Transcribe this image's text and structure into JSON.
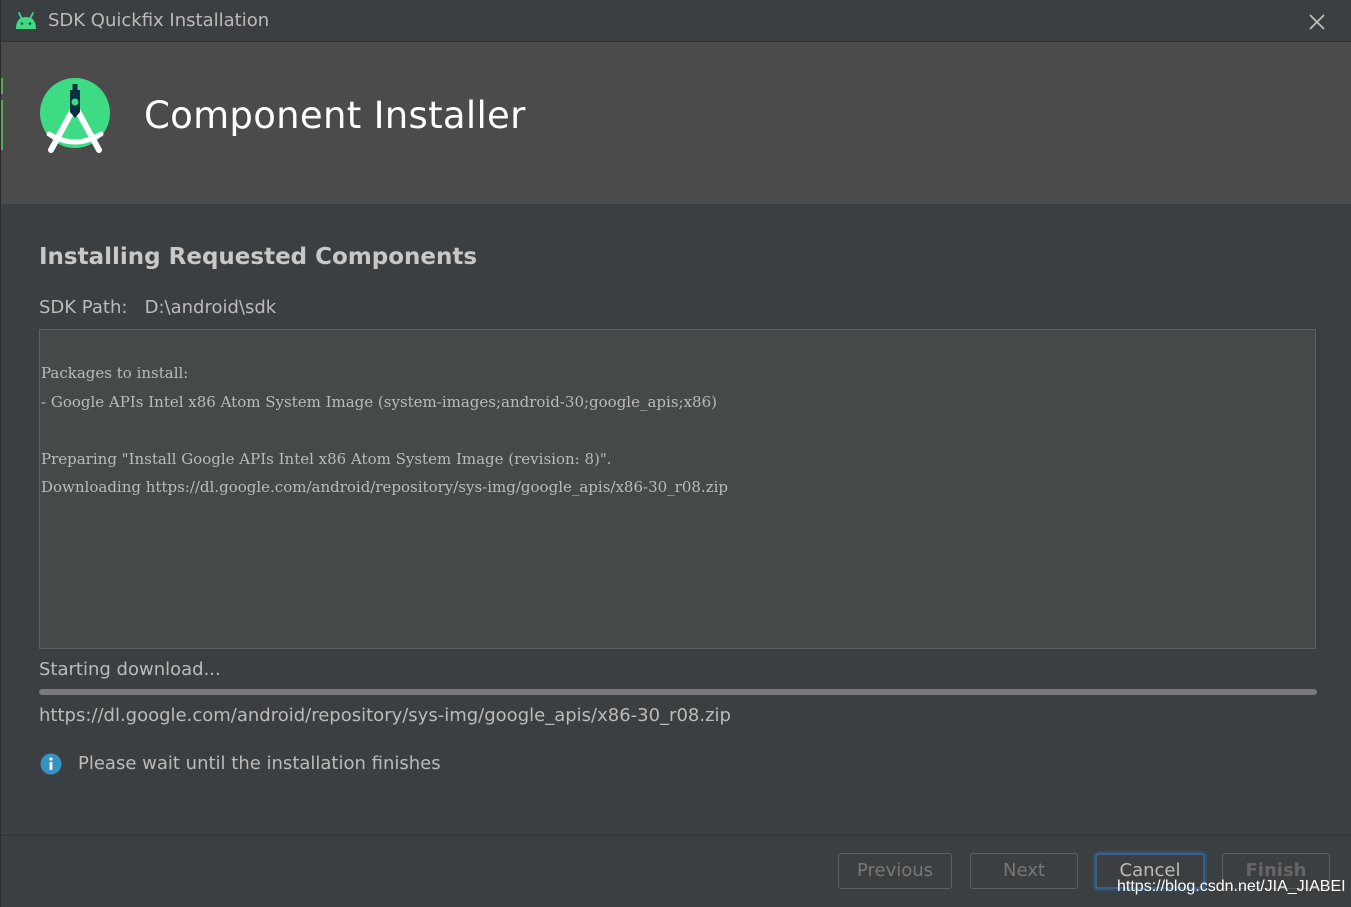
{
  "window": {
    "title": "SDK Quickfix Installation",
    "app_icon": "android-robot-icon",
    "close_icon": "close-icon"
  },
  "banner": {
    "logo": "android-studio-logo-icon",
    "title": "Component Installer"
  },
  "content": {
    "heading": "Installing Requested Components",
    "sdk_path_label": "SDK Path:",
    "sdk_path_value": "D:\\android\\sdk",
    "log_lines": [
      "Packages to install:",
      "- Google APIs Intel x86 Atom System Image (system-images;android-30;google_apis;x86)",
      "",
      "Preparing \"Install Google APIs Intel x86 Atom System Image (revision: 8)\".",
      "Downloading https://dl.google.com/android/repository/sys-img/google_apis/x86-30_r08.zip"
    ],
    "status": "Starting download...",
    "progress": 0,
    "download_url": "https://dl.google.com/android/repository/sys-img/google_apis/x86-30_r08.zip",
    "info_icon": "info-icon",
    "info_message": "Please wait until the installation finishes"
  },
  "footer": {
    "previous_label": "Previous",
    "next_label": "Next",
    "cancel_label": "Cancel",
    "finish_label": "Finish"
  },
  "watermark": "https://blog.csdn.net/JIA_JIABEI",
  "colors": {
    "background": "#3c3f41",
    "banner": "#4b4b4b",
    "accent_green": "#3ddc84",
    "focus_blue": "#3d6185",
    "info_blue": "#3592c4"
  }
}
